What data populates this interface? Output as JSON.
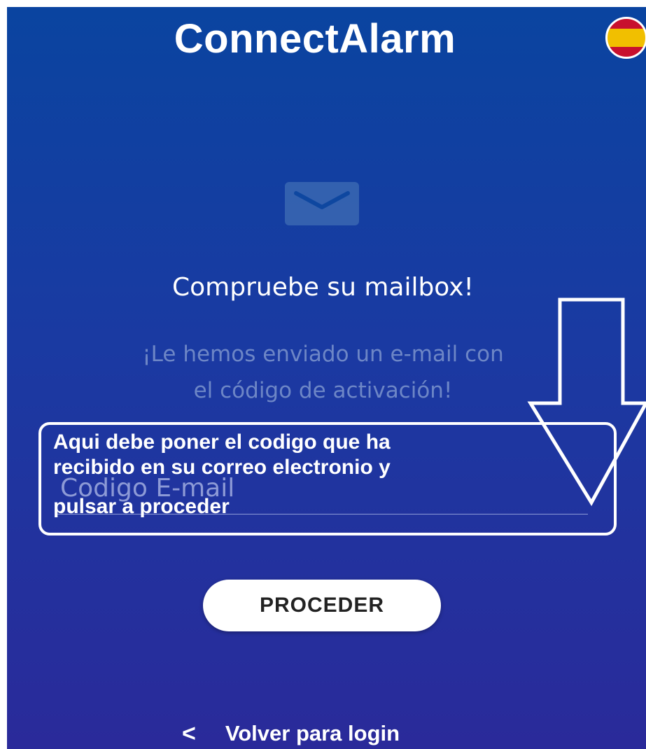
{
  "app": {
    "title": "ConnectAlarm",
    "language_flag": "spain-flag"
  },
  "main": {
    "icon": "mail-icon",
    "heading": "Compruebe su mailbox!",
    "message_line1": "¡Le hemos enviado un e-mail con",
    "message_line2": "el código de activación!",
    "code_field": {
      "placeholder": "Codigo E-mail",
      "value": ""
    },
    "proceed_label": "PROCEDER",
    "back_chevron": "<",
    "back_label": "Volver para login"
  },
  "annotation": {
    "line1": "Aqui debe poner el codigo que ha",
    "line2": "recibido en su correo electronio y",
    "line3": "pulsar a proceder"
  },
  "colors": {
    "background_top": "#0a44a0",
    "background_bottom": "#2a2a9a",
    "button_bg": "#ffffff",
    "subtext": "#6d86c6"
  }
}
